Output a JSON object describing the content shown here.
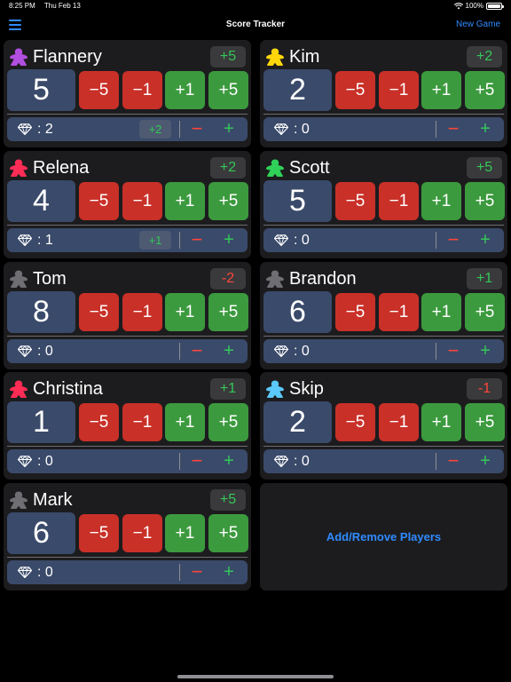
{
  "status": {
    "time": "8:25 PM",
    "date": "Thu Feb 13",
    "battery": "100%",
    "battery_level": 1.0
  },
  "nav": {
    "title": "Score Tracker",
    "new_game": "New Game"
  },
  "buttons": {
    "minus5": "−5",
    "minus1": "−1",
    "plus1": "+1",
    "plus5": "+5"
  },
  "gem_controls": {
    "minus": "−",
    "plus": "+"
  },
  "players": [
    {
      "name": "Flannery",
      "score": "5",
      "delta": "+5",
      "delta_sign": "pos",
      "gem_text": ": 2",
      "gem_delta": "+2",
      "color": "#b24ee0"
    },
    {
      "name": "Kim",
      "score": "2",
      "delta": "+2",
      "delta_sign": "pos",
      "gem_text": ": 0",
      "gem_delta": "",
      "color": "#ffd60a"
    },
    {
      "name": "Relena",
      "score": "4",
      "delta": "+2",
      "delta_sign": "pos",
      "gem_text": ": 1",
      "gem_delta": "+1",
      "color": "#ff2d55"
    },
    {
      "name": "Scott",
      "score": "5",
      "delta": "+5",
      "delta_sign": "pos",
      "gem_text": ": 0",
      "gem_delta": "",
      "color": "#30d158"
    },
    {
      "name": "Tom",
      "score": "8",
      "delta": "-2",
      "delta_sign": "neg",
      "gem_text": ": 0",
      "gem_delta": "",
      "color": "#6e6e73"
    },
    {
      "name": "Brandon",
      "score": "6",
      "delta": "+1",
      "delta_sign": "pos",
      "gem_text": ": 0",
      "gem_delta": "",
      "color": "#6e6e73"
    },
    {
      "name": "Christina",
      "score": "1",
      "delta": "+1",
      "delta_sign": "pos",
      "gem_text": ": 0",
      "gem_delta": "",
      "color": "#ff2d55"
    },
    {
      "name": "Skip",
      "score": "2",
      "delta": "-1",
      "delta_sign": "neg",
      "gem_text": ": 0",
      "gem_delta": "",
      "color": "#5ac8fa"
    },
    {
      "name": "Mark",
      "score": "6",
      "delta": "+5",
      "delta_sign": "pos",
      "gem_text": ": 0",
      "gem_delta": "",
      "color": "#6e6e73"
    }
  ],
  "add_players": {
    "label": "Add/Remove Players"
  }
}
